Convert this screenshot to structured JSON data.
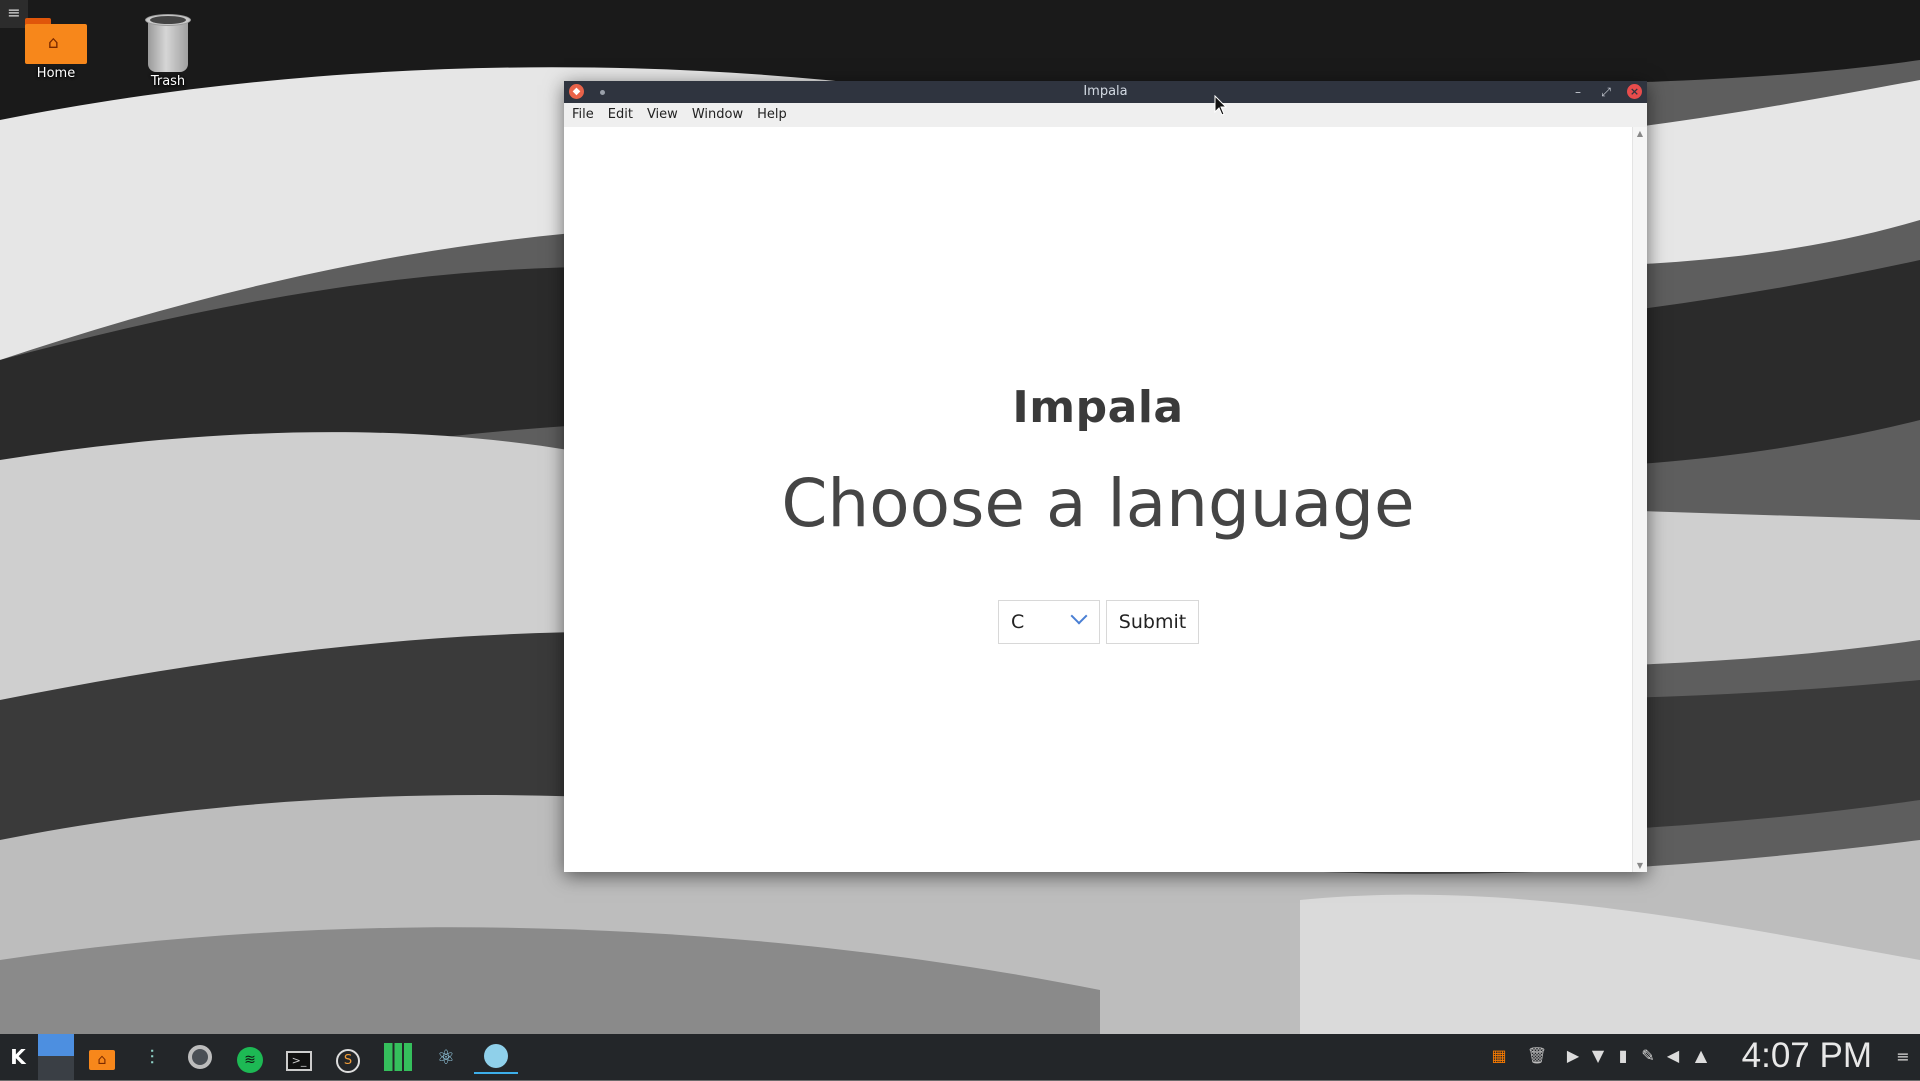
{
  "desktop": {
    "menu_toggle_icon": "hamburger-icon",
    "icons": [
      {
        "label": "Home",
        "icon": "home-folder-icon"
      },
      {
        "label": "Trash",
        "icon": "trash-icon"
      }
    ]
  },
  "window": {
    "title": "Impala",
    "app_icon": "impala-app-icon",
    "controls": [
      "minimize-icon",
      "maximize-icon",
      "close-icon"
    ],
    "menu": [
      "File",
      "Edit",
      "View",
      "Window",
      "Help"
    ]
  },
  "page": {
    "heading": "Impala",
    "subheading": "Choose a language",
    "language_select": {
      "value": "C"
    },
    "submit_label": "Submit"
  },
  "taskbar": {
    "launchers": [
      "kde-menu-icon",
      "desktop-pager-icon",
      "file-manager-icon",
      "mixer-icon",
      "chrome-icon",
      "spotify-icon",
      "terminal-icon",
      "sublime-icon",
      "manjaro-icon",
      "react-devtools-icon",
      "active-app-icon"
    ],
    "tray": [
      "vlc-icon",
      "trash-icon",
      "media-play-icon",
      "wifi-icon",
      "battery-icon",
      "clipboard-icon",
      "volume-icon",
      "expand-tray-icon"
    ],
    "clock": "4:07 PM"
  },
  "colors": {
    "titlebar": "#2f343f",
    "taskbar": "#232629",
    "accent": "#3daee9",
    "close": "#e74c4c"
  }
}
